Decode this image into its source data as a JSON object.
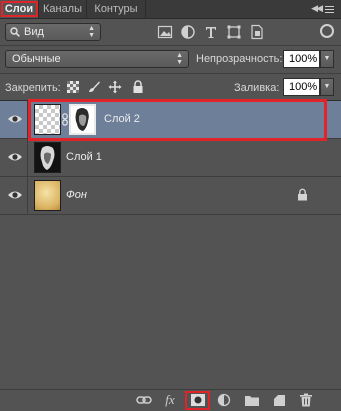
{
  "tabs": [
    {
      "label": "Слои",
      "active": true
    },
    {
      "label": "Каналы",
      "active": false
    },
    {
      "label": "Контуры",
      "active": false
    }
  ],
  "filter": {
    "label": "Вид"
  },
  "blend_mode": {
    "value": "Обычные"
  },
  "opacity": {
    "label": "Непрозрачность:",
    "value": "100%"
  },
  "lock": {
    "label": "Закрепить:"
  },
  "fill": {
    "label": "Заливка:",
    "value": "100%"
  },
  "layers": [
    {
      "name": "Слой 2",
      "selected": true,
      "has_mask": true,
      "linked": true
    },
    {
      "name": "Слой 1",
      "selected": false
    },
    {
      "name": "Фон",
      "selected": false,
      "locked": true
    }
  ],
  "footer_icons": [
    "link-layers-icon",
    "fx-icon",
    "add-mask-icon",
    "adjustment-layer-icon",
    "new-group-icon",
    "new-layer-icon",
    "trash-icon"
  ],
  "colors": {
    "panel": "#535353",
    "selection": "#6e7f99",
    "highlight": "#e0242a"
  }
}
